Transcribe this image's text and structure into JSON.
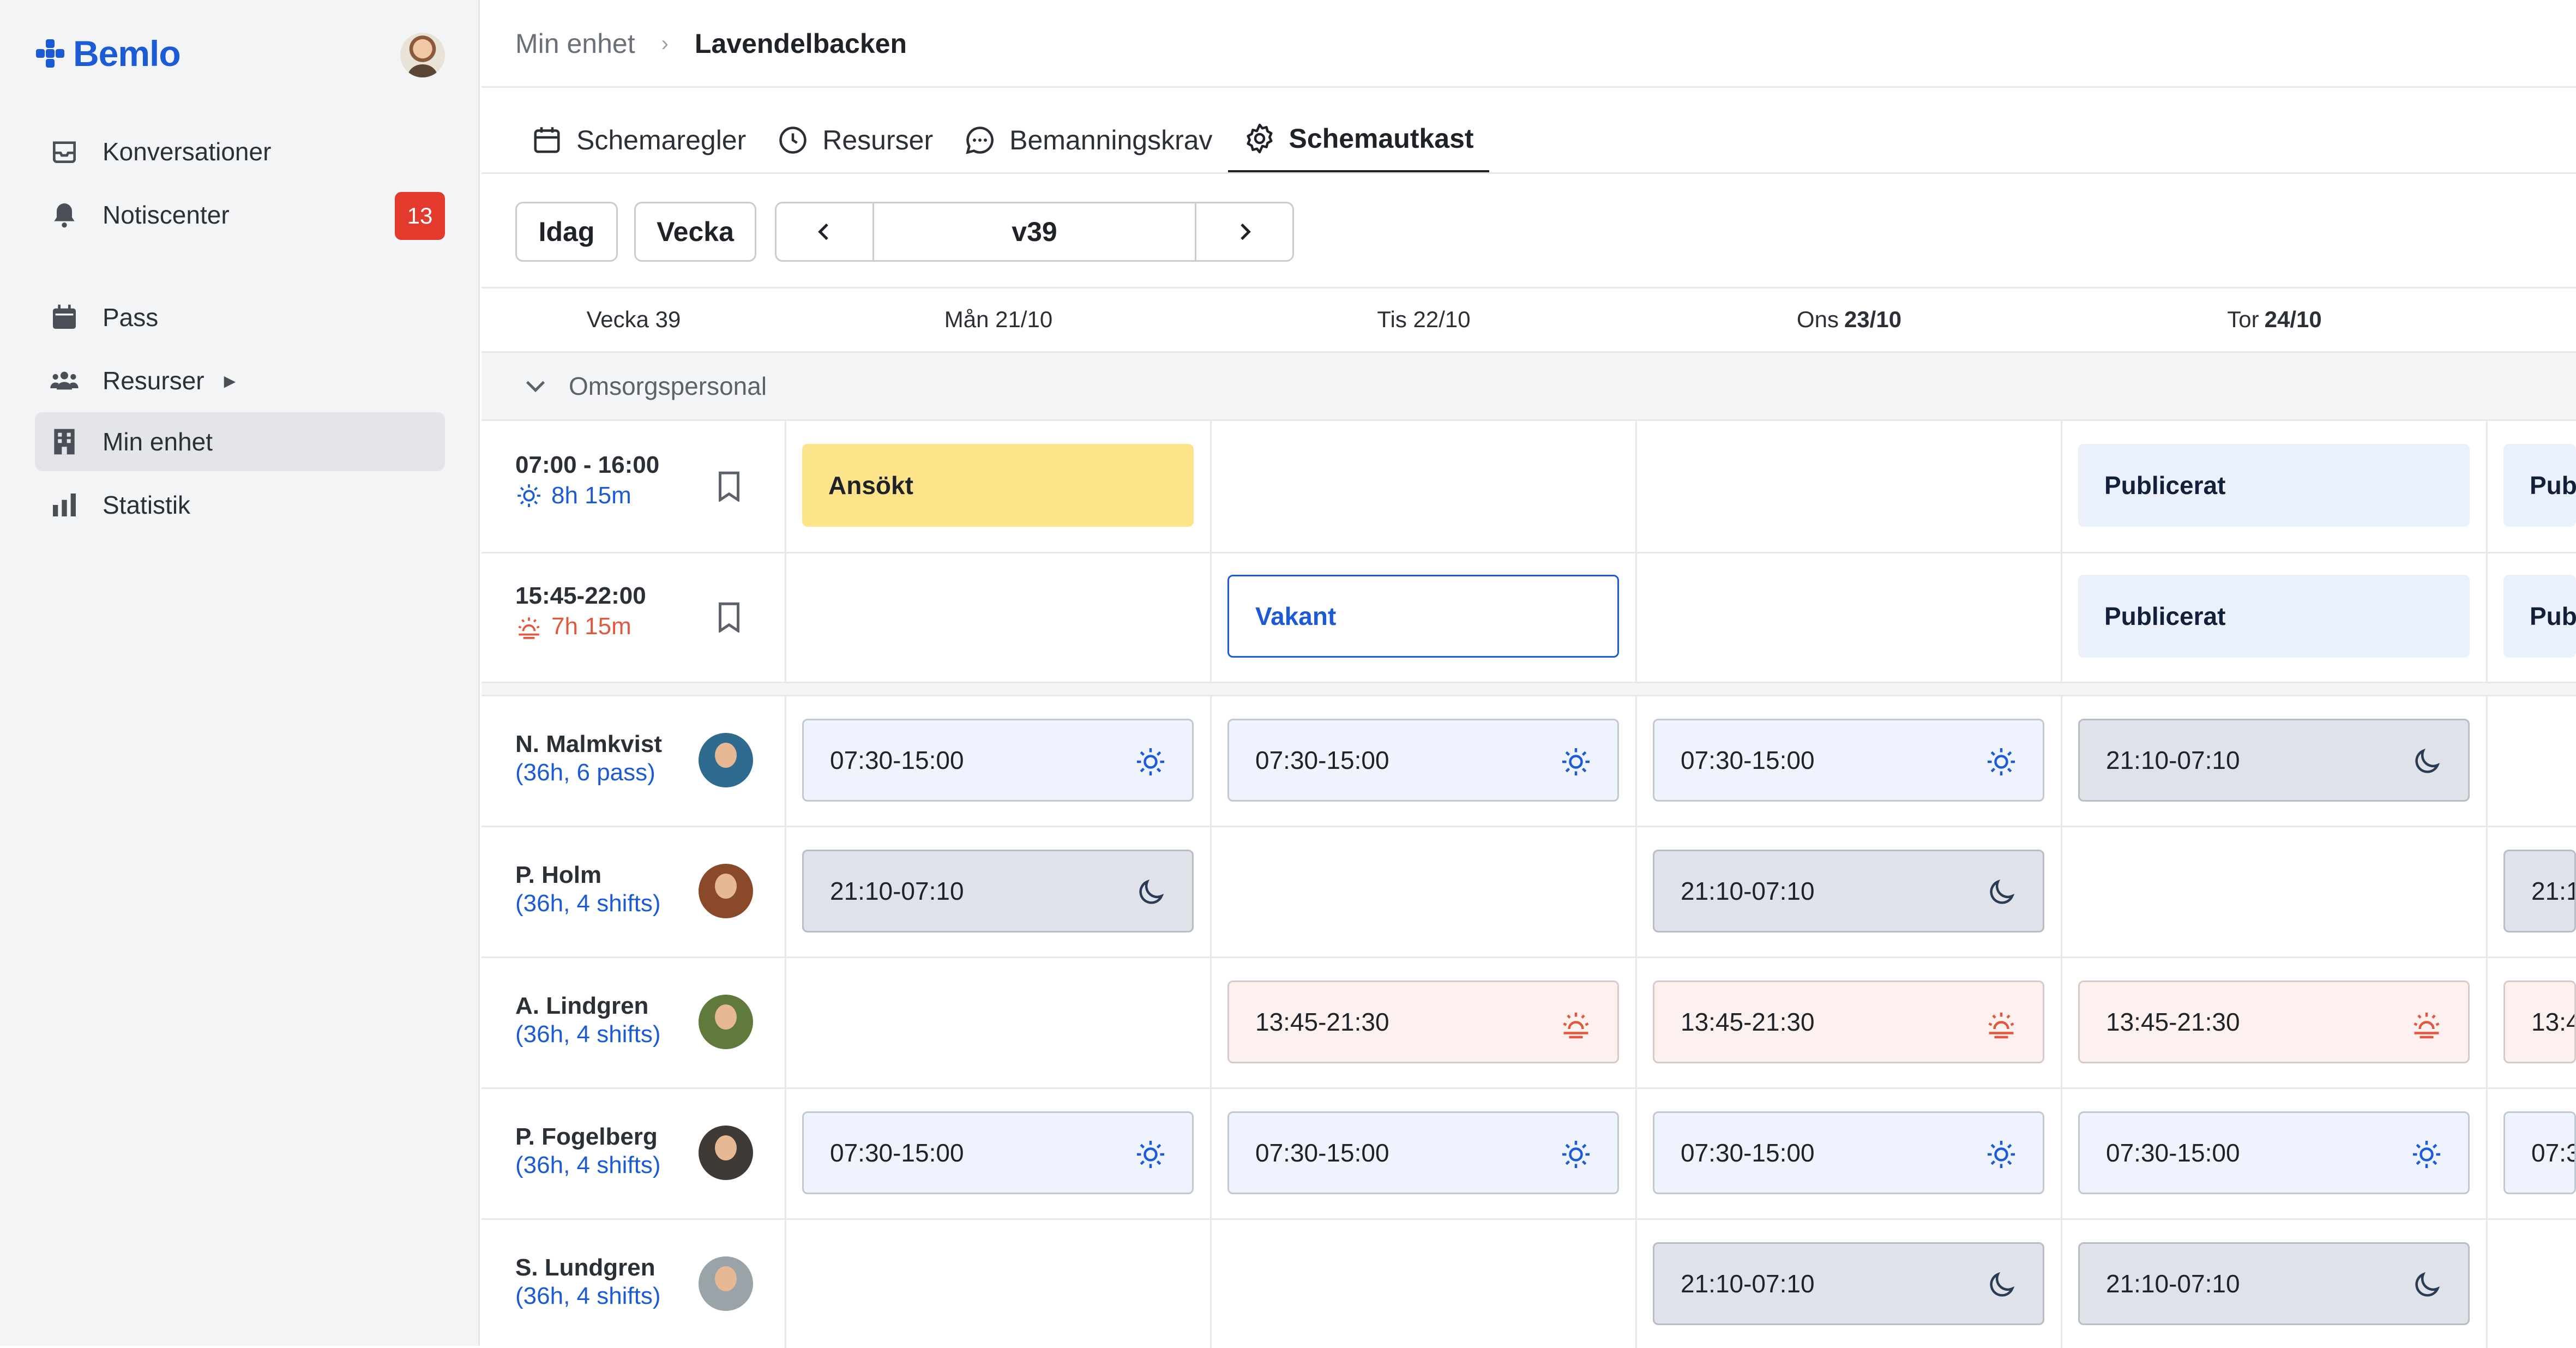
{
  "app": {
    "brand": "Bemlo",
    "brand_color": "#1d5bd6"
  },
  "sidebar": {
    "items": [
      {
        "label": "Konversationer",
        "icon": "inbox-icon"
      },
      {
        "label": "Notiscenter",
        "icon": "bell-icon",
        "badge": "13"
      },
      {
        "label": "Pass",
        "icon": "calendar-icon"
      },
      {
        "label": "Resurser",
        "icon": "people-icon",
        "arrow": "▶"
      },
      {
        "label": "Min enhet",
        "icon": "building-icon",
        "active": true
      },
      {
        "label": "Statistik",
        "icon": "bar-chart-icon"
      }
    ]
  },
  "breadcrumb": {
    "parent": "Min enhet",
    "separator": "›",
    "current": "Lavendelbacken"
  },
  "tabs": [
    {
      "label": "Schemaregler",
      "icon": "calendar-icon"
    },
    {
      "label": "Resurser",
      "icon": "clock-icon"
    },
    {
      "label": "Bemanningskrav",
      "icon": "chat-icon"
    },
    {
      "label": "Schemautkast",
      "icon": "gear-icon",
      "active": true
    }
  ],
  "toolbar": {
    "today": "Idag",
    "view": "Vecka",
    "prev": "‹",
    "week": "v39",
    "next": "›"
  },
  "header": {
    "week_label": "Vecka 39",
    "days": [
      {
        "name": "Mån",
        "date": "21/10",
        "bold": false
      },
      {
        "name": "Tis",
        "date": "22/10",
        "bold": false
      },
      {
        "name": "Ons",
        "date": "23/10",
        "bold": true
      },
      {
        "name": "Tor",
        "date": "24/10",
        "bold": true
      }
    ]
  },
  "group": {
    "label": "Omsorgspersonal"
  },
  "shift_defs": [
    {
      "time": "07:00 - 16:00",
      "duration": "8h 15m",
      "icon": "sun-icon",
      "color": "#1d5bd6"
    },
    {
      "time": "15:45-22:00",
      "duration": "7h 15m",
      "icon": "sunset-icon",
      "color": "#e4573f"
    }
  ],
  "open_shifts": [
    [
      "Ansökt",
      "",
      "",
      "Publicerat",
      "Pub"
    ],
    [
      "",
      "Vakant",
      "",
      "Publicerat",
      "Pub"
    ]
  ],
  "staff": [
    {
      "name": "N. Malmkvist",
      "info": "(36h, 6 pass)",
      "shifts": [
        "07:30-15:00",
        "07:30-15:00",
        "07:30-15:00",
        "21:10-07:10",
        ""
      ]
    },
    {
      "name": "P. Holm",
      "info": "(36h, 4 shifts)",
      "shifts": [
        "21:10-07:10",
        "",
        "21:10-07:10",
        "",
        "21:1"
      ]
    },
    {
      "name": "A. Lindgren",
      "info": "(36h, 4 shifts)",
      "shifts": [
        "",
        "13:45-21:30",
        "13:45-21:30",
        "13:45-21:30",
        "13:4"
      ]
    },
    {
      "name": "P. Fogelberg",
      "info": "(36h, 4 shifts)",
      "shifts": [
        "07:30-15:00",
        "07:30-15:00",
        "07:30-15:00",
        "07:30-15:00",
        "07:3"
      ]
    },
    {
      "name": "S. Lundgren",
      "info": "(36h, 4 shifts)",
      "shifts": [
        "",
        "",
        "21:10-07:10",
        "21:10-07:10",
        ""
      ]
    }
  ],
  "colors": {
    "applied": "#fde48a",
    "published": "#eaf1fd",
    "vacant_border": "#1d5bd6",
    "day_shift": "#eef3fd",
    "night_shift": "#dfe2e8",
    "evening_shift": "#fdf1f0",
    "badge": "#e23b2e"
  }
}
